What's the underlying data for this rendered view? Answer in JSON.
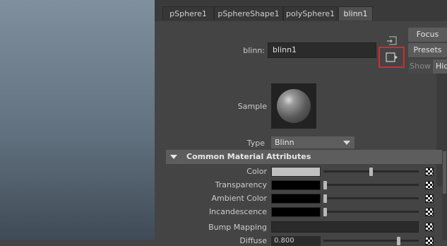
{
  "tabs": [
    {
      "label": "pSphere1",
      "active": false
    },
    {
      "label": "pSphereShape1",
      "active": false
    },
    {
      "label": "polySphere1",
      "active": false
    },
    {
      "label": "blinn1",
      "active": true
    }
  ],
  "material": {
    "name_label": "blinn:",
    "name_value": "blinn1",
    "sample_label": "Sample",
    "type_label": "Type",
    "type_value": "Blinn"
  },
  "side_panel": {
    "focus_label": "Focus",
    "presets_label": "Presets",
    "show_label": "Show",
    "hide_label": "Hide"
  },
  "section": {
    "title": "Common Material Attributes"
  },
  "attributes": {
    "color_label": "Color",
    "transparency_label": "Transparency",
    "ambient_label": "Ambient Color",
    "incandescence_label": "Incandescence",
    "bump_label": "Bump Mapping",
    "diffuse_label": "Diffuse",
    "diffuse_value": "0.800"
  },
  "levels": {
    "color": 0.5,
    "transparency": 0,
    "ambient": 0,
    "incandescence": 0,
    "diffuse": 0.8
  },
  "colors": {
    "color_swatch": "#c0c0c0",
    "transparency_swatch": "#000000",
    "ambient_swatch": "#000000",
    "incandescence_swatch": "#000000",
    "highlight_box": "#e0262b",
    "viewport_top": "#7f8f9e",
    "viewport_bottom": "#3f4b56"
  },
  "icons": {
    "copy_tab": "copy-tab-icon",
    "output_connection": "output-connection-icon",
    "collapse": "collapse-arrow-icon",
    "map_button": "checker-map-icon"
  }
}
